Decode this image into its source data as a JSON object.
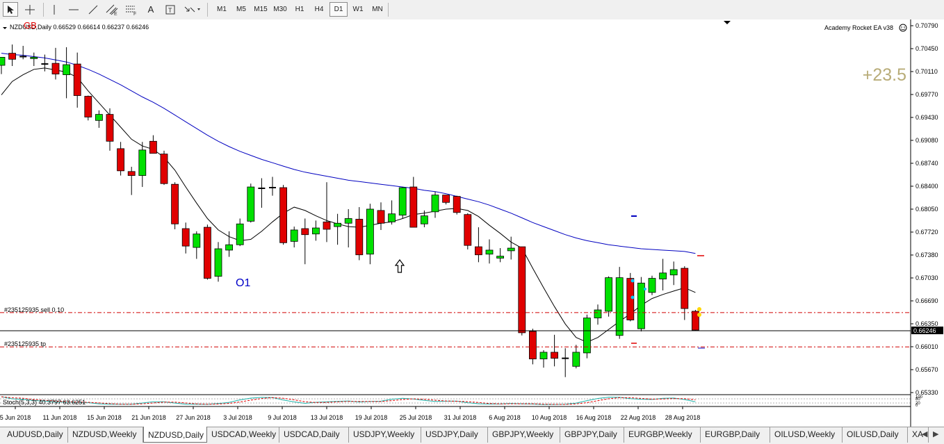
{
  "toolbar": {
    "timeframes": [
      "M1",
      "M5",
      "M15",
      "M30",
      "H1",
      "H4",
      "D1",
      "W1",
      "MN"
    ],
    "active_timeframe": "D1"
  },
  "chart": {
    "header": "NZDUSD,Daily  0.66529 0.66614 0.66237 0.66246",
    "ea_label": "Academy Rocket EA v38",
    "overlay_left": "GB",
    "profit": "+23.5",
    "wave_label": "O1",
    "sell_label": "#235125935 sell 0.10",
    "tp_label": "#235125935 tp",
    "current_price": "0.66246",
    "price_axis": [
      "0.70790",
      "0.70450",
      "0.70110",
      "0.69770",
      "0.69430",
      "0.69080",
      "0.68740",
      "0.68400",
      "0.68050",
      "0.67720",
      "0.67380",
      "0.67030",
      "0.66690",
      "0.66350",
      "0.66010",
      "0.65670",
      "0.65330"
    ],
    "date_axis": [
      "5 Jun 2018",
      "11 Jun 2018",
      "15 Jun 2018",
      "21 Jun 2018",
      "27 Jun 2018",
      "3 Jul 2018",
      "9 Jul 2018",
      "13 Jul 2018",
      "19 Jul 2018",
      "25 Jul 2018",
      "31 Jul 2018",
      "6 Aug 2018",
      "10 Aug 2018",
      "16 Aug 2018",
      "22 Aug 2018",
      "28 Aug 2018"
    ],
    "stoch_label": "Stoch(5,3,3) 40.3797 63.6251",
    "stoch_axis": [
      "100",
      "80",
      "20",
      "0"
    ],
    "colors": {
      "bull": "#00e000",
      "bear": "#e00000",
      "ma_slow": "#0000c0",
      "ma_fast": "#000000",
      "level": "#d00000"
    }
  },
  "chart_data": {
    "type": "candlestick",
    "symbol": "NZDUSD",
    "timeframe": "Daily",
    "ylim": [
      0.6533,
      0.7079
    ],
    "sell_level": 0.6651,
    "tp_level": 0.66,
    "current": 0.66246,
    "candles": [
      [
        0.7019,
        0.7031,
        0.7006,
        0.7031
      ],
      [
        0.7037,
        0.705,
        0.7018,
        0.7028
      ],
      [
        0.7032,
        0.7048,
        0.7028,
        0.7031
      ],
      [
        0.7029,
        0.7038,
        0.7018,
        0.7031
      ],
      [
        0.7021,
        0.7035,
        0.701,
        0.7021
      ],
      [
        0.7022,
        0.7045,
        0.6998,
        0.7006
      ],
      [
        0.7005,
        0.7046,
        0.697,
        0.702
      ],
      [
        0.7021,
        0.7038,
        0.6956,
        0.6974
      ],
      [
        0.6973,
        0.6974,
        0.6937,
        0.6942
      ],
      [
        0.6937,
        0.6952,
        0.6926,
        0.6946
      ],
      [
        0.6946,
        0.6955,
        0.6892,
        0.6906
      ],
      [
        0.6895,
        0.6905,
        0.6855,
        0.6862
      ],
      [
        0.6861,
        0.6868,
        0.6826,
        0.6855
      ],
      [
        0.6855,
        0.6905,
        0.6838,
        0.6893
      ],
      [
        0.6906,
        0.6915,
        0.6888,
        0.6888
      ],
      [
        0.6887,
        0.6892,
        0.6841,
        0.6843
      ],
      [
        0.6842,
        0.6845,
        0.6775,
        0.6783
      ],
      [
        0.6776,
        0.6785,
        0.6739,
        0.675
      ],
      [
        0.6748,
        0.6772,
        0.6731,
        0.6768
      ],
      [
        0.6778,
        0.6782,
        0.67,
        0.6702
      ],
      [
        0.6705,
        0.6756,
        0.6697,
        0.6746
      ],
      [
        0.6744,
        0.6772,
        0.6734,
        0.6752
      ],
      [
        0.6752,
        0.6791,
        0.675,
        0.6783
      ],
      [
        0.6787,
        0.6843,
        0.6785,
        0.6838
      ],
      [
        0.6836,
        0.6851,
        0.6807,
        0.6836
      ],
      [
        0.6837,
        0.6853,
        0.6825,
        0.6836
      ],
      [
        0.6837,
        0.6841,
        0.6752,
        0.6755
      ],
      [
        0.6757,
        0.6779,
        0.6748,
        0.6774
      ],
      [
        0.6776,
        0.6791,
        0.6723,
        0.6767
      ],
      [
        0.6768,
        0.6788,
        0.6758,
        0.6777
      ],
      [
        0.6786,
        0.6845,
        0.6756,
        0.6775
      ],
      [
        0.6779,
        0.6798,
        0.6752,
        0.6784
      ],
      [
        0.6784,
        0.6805,
        0.6748,
        0.6791
      ],
      [
        0.679,
        0.6808,
        0.6729,
        0.6737
      ],
      [
        0.6738,
        0.6813,
        0.6723,
        0.6805
      ],
      [
        0.6803,
        0.6815,
        0.6774,
        0.6784
      ],
      [
        0.6786,
        0.6818,
        0.6782,
        0.6798
      ],
      [
        0.6796,
        0.6838,
        0.6791,
        0.6837
      ],
      [
        0.6838,
        0.6853,
        0.6778,
        0.6778
      ],
      [
        0.6783,
        0.6803,
        0.6778,
        0.6795
      ],
      [
        0.6801,
        0.6831,
        0.6792,
        0.6826
      ],
      [
        0.6826,
        0.6826,
        0.6812,
        0.6815
      ],
      [
        0.6824,
        0.6825,
        0.6797,
        0.68
      ],
      [
        0.6797,
        0.6799,
        0.6745,
        0.6751
      ],
      [
        0.6749,
        0.6778,
        0.6726,
        0.6737
      ],
      [
        0.6738,
        0.676,
        0.6724,
        0.6744
      ],
      [
        0.6732,
        0.6747,
        0.6726,
        0.6735
      ],
      [
        0.6743,
        0.6764,
        0.673,
        0.6747
      ],
      [
        0.6749,
        0.6749,
        0.6617,
        0.6621
      ],
      [
        0.6623,
        0.6627,
        0.6574,
        0.6582
      ],
      [
        0.6582,
        0.6595,
        0.6569,
        0.6592
      ],
      [
        0.6592,
        0.6618,
        0.6571,
        0.6583
      ],
      [
        0.6583,
        0.6598,
        0.6555,
        0.6583
      ],
      [
        0.6571,
        0.6603,
        0.6568,
        0.6592
      ],
      [
        0.6591,
        0.6648,
        0.6583,
        0.6643
      ],
      [
        0.6643,
        0.6663,
        0.6633,
        0.6655
      ],
      [
        0.6653,
        0.6705,
        0.6645,
        0.6703
      ],
      [
        0.6617,
        0.6719,
        0.6612,
        0.6703
      ],
      [
        0.6702,
        0.671,
        0.6638,
        0.664
      ],
      [
        0.6627,
        0.6704,
        0.6623,
        0.6695
      ],
      [
        0.6681,
        0.6706,
        0.6677,
        0.6702
      ],
      [
        0.6701,
        0.6731,
        0.6684,
        0.671
      ],
      [
        0.6707,
        0.6727,
        0.6692,
        0.6715
      ],
      [
        0.6717,
        0.672,
        0.664,
        0.6657
      ],
      [
        0.6653,
        0.6655,
        0.6624,
        0.6625
      ]
    ],
    "ma_fast": [
      0.6975,
      0.6995,
      0.7005,
      0.7013,
      0.7015,
      0.7012,
      0.7009,
      0.7001,
      0.6981,
      0.6963,
      0.6945,
      0.6927,
      0.6909,
      0.6899,
      0.6894,
      0.6882,
      0.6863,
      0.6838,
      0.6814,
      0.6791,
      0.6774,
      0.6764,
      0.6758,
      0.676,
      0.6772,
      0.6786,
      0.6799,
      0.6808,
      0.6803,
      0.6795,
      0.6788,
      0.6783,
      0.6779,
      0.6778,
      0.6781,
      0.6784,
      0.6786,
      0.6791,
      0.6797,
      0.6799,
      0.6802,
      0.6805,
      0.6806,
      0.6803,
      0.6794,
      0.6781,
      0.6769,
      0.6756,
      0.6747,
      0.6717,
      0.6688,
      0.666,
      0.6634,
      0.6614,
      0.6607,
      0.6614,
      0.6626,
      0.6638,
      0.6649,
      0.6662,
      0.6672,
      0.6678,
      0.6683,
      0.6688,
      0.6681
    ],
    "ma_slow": [
      0.7037,
      0.7035,
      0.7034,
      0.7032,
      0.703,
      0.7027,
      0.7024,
      0.7019,
      0.7013,
      0.7006,
      0.6998,
      0.699,
      0.6981,
      0.6972,
      0.6964,
      0.6955,
      0.6945,
      0.6935,
      0.6925,
      0.6915,
      0.6906,
      0.6898,
      0.6891,
      0.6885,
      0.6879,
      0.6874,
      0.6869,
      0.6864,
      0.686,
      0.6857,
      0.6854,
      0.6851,
      0.6848,
      0.6846,
      0.6844,
      0.6842,
      0.684,
      0.6838,
      0.6836,
      0.6833,
      0.6831,
      0.6828,
      0.6824,
      0.682,
      0.6816,
      0.6811,
      0.6805,
      0.6799,
      0.6792,
      0.6785,
      0.6779,
      0.6773,
      0.6767,
      0.6762,
      0.6758,
      0.6755,
      0.6752,
      0.675,
      0.6748,
      0.6746,
      0.6745,
      0.6744,
      0.6743,
      0.6742,
      0.6739
    ]
  },
  "tabs": [
    {
      "label": "AUDUSD,Daily",
      "active": false
    },
    {
      "label": "NZDUSD,Weekly",
      "active": false
    },
    {
      "label": "NZDUSD,Daily",
      "active": true
    },
    {
      "label": "USDCAD,Weekly",
      "active": false
    },
    {
      "label": "USDCAD,Daily",
      "active": false
    },
    {
      "label": "USDJPY,Weekly",
      "active": false
    },
    {
      "label": "USDJPY,Daily",
      "active": false
    },
    {
      "label": "GBPJPY,Weekly",
      "active": false
    },
    {
      "label": "GBPJPY,Daily",
      "active": false
    },
    {
      "label": "EURGBP,Weekly",
      "active": false
    },
    {
      "label": "EURGBP,Daily",
      "active": false
    },
    {
      "label": "OILUSD,Weekly",
      "active": false
    },
    {
      "label": "OILUSD,Daily",
      "active": false
    },
    {
      "label": "XA",
      "active": false
    }
  ]
}
